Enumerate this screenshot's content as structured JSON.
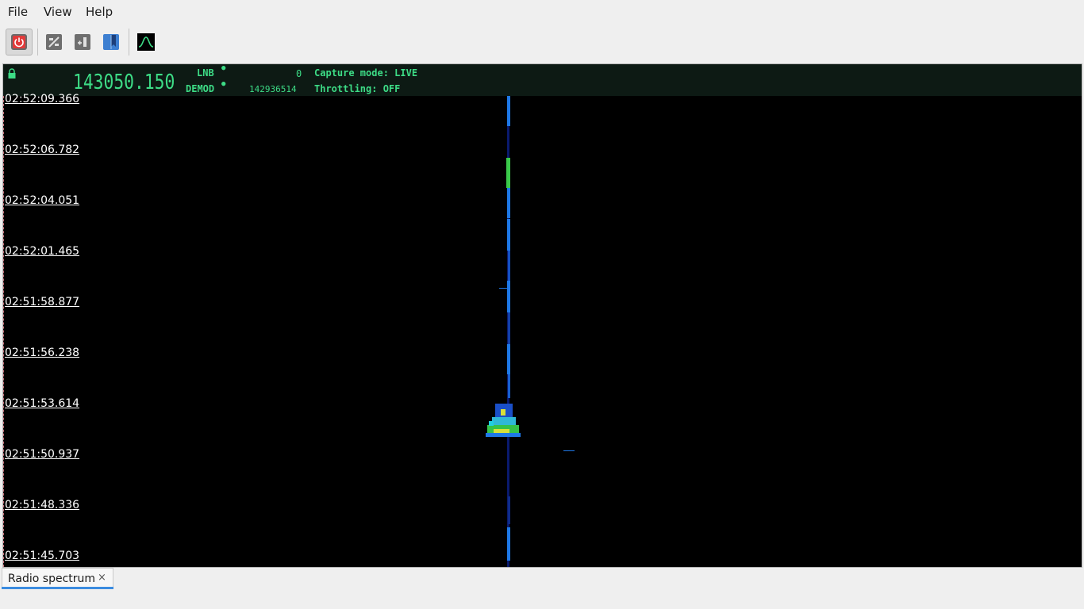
{
  "menu": {
    "file": "File",
    "view": "View",
    "help": "Help"
  },
  "toolbar": {
    "buttons": [
      {
        "name": "power-button",
        "icon": "power-icon"
      },
      {
        "name": "settings-button",
        "icon": "sliders-icon"
      },
      {
        "name": "add-panel-button",
        "icon": "add-icon"
      },
      {
        "name": "bookmark-button",
        "icon": "bookmark-icon"
      },
      {
        "name": "spectrum-button",
        "icon": "spectrum-icon"
      }
    ]
  },
  "lcd": {
    "frequency": "143050.150",
    "lnb_label": "LNB",
    "lnb_value": "0",
    "demod_label": "DEMOD",
    "demod_value": "142936514",
    "capture_mode": "Capture mode: LIVE",
    "throttling": "Throttling: OFF"
  },
  "waterfall": {
    "timestamps": [
      "02:52:09.366",
      "02:52:06.782",
      "02:52:04.051",
      "02:52:01.465",
      "02:51:58.877",
      "02:51:56.238",
      "02:51:53.614",
      "02:51:50.937",
      "02:51:48.336",
      "02:51:45.703"
    ]
  },
  "tabs": [
    {
      "label": "Radio spectrum",
      "close": "×"
    }
  ],
  "colors": {
    "lcd_green": "#3ddc86",
    "signal_blue": "#1e78e6",
    "signal_green": "#3ac94a",
    "tab_accent": "#3c8ce0"
  }
}
